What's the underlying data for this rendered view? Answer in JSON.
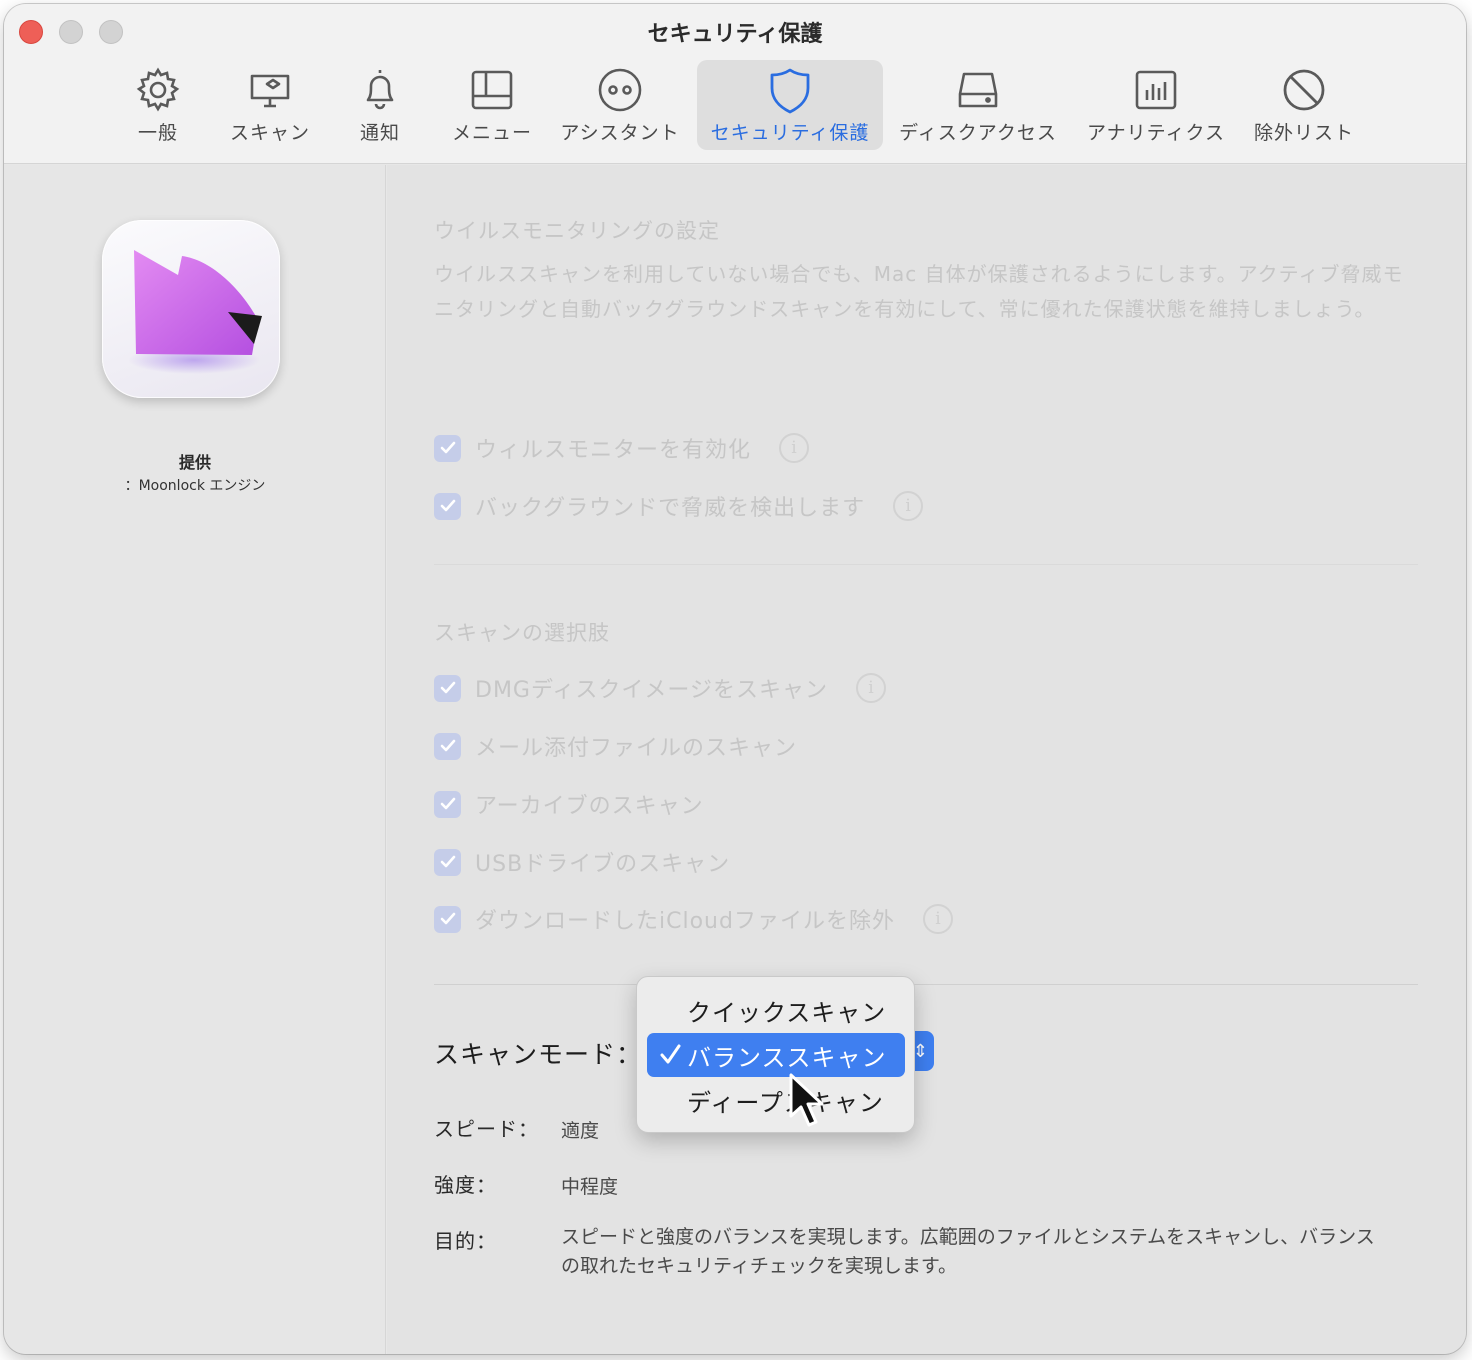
{
  "window": {
    "title": "セキュリティ保護"
  },
  "toolbar": {
    "tabs": [
      {
        "label": "一般",
        "icon": "gear-icon"
      },
      {
        "label": "スキャン",
        "icon": "monitor-icon"
      },
      {
        "label": "通知",
        "icon": "bell-icon"
      },
      {
        "label": "メニュー",
        "icon": "menu-bar-icon"
      },
      {
        "label": "アシスタント",
        "icon": "assistant-icon"
      },
      {
        "label": "セキュリティ保護",
        "icon": "shield-icon",
        "selected": true
      },
      {
        "label": "ディスクアクセス",
        "icon": "drive-icon"
      },
      {
        "label": "アナリティクス",
        "icon": "analytics-icon"
      },
      {
        "label": "除外リスト",
        "icon": "prohibited-icon"
      }
    ]
  },
  "sidebar": {
    "provided_label": "提供",
    "provided_value": "：Moonlock エンジン"
  },
  "virus_monitoring": {
    "title": "ウイルスモニタリングの設定",
    "description": "ウイルススキャンを利用していない場合でも、Mac 自体が保護されるようにします。アクティブ脅威モニタリングと自動バックグラウンドスキャンを有効にして、常に優れた保護状態を維持しましょう。",
    "options": [
      {
        "label": "ウィルスモニターを有効化",
        "checked": true,
        "info": true
      },
      {
        "label": "バックグラウンドで脅威を検出します",
        "checked": true,
        "info": true
      }
    ]
  },
  "scan_options": {
    "title": "スキャンの選択肢",
    "options": [
      {
        "label": "DMGディスクイメージをスキャン",
        "checked": true,
        "info": true
      },
      {
        "label": "メール添付ファイルのスキャン",
        "checked": true,
        "info": false
      },
      {
        "label": "アーカイブのスキャン",
        "checked": true,
        "info": false
      },
      {
        "label": "USBドライブのスキャン",
        "checked": true,
        "info": false
      },
      {
        "label": "ダウンロードしたiCloudファイルを除外",
        "checked": true,
        "info": true
      }
    ]
  },
  "scan_mode": {
    "label": "スキャンモード：",
    "menu_items": [
      {
        "label": "クイックスキャン",
        "selected": false
      },
      {
        "label": "バランススキャン",
        "selected": true
      },
      {
        "label": "ディープスキャン",
        "selected": false
      }
    ]
  },
  "details": {
    "speed_label": "スピード：",
    "speed_value": "適度",
    "strength_label": "強度：",
    "strength_value": "中程度",
    "purpose_label": "目的：",
    "purpose_value": "スピードと強度のバランスを実現します。広範囲のファイルとシステムをスキャンし、バランスの取れたセキュリティチェックを実現します。"
  },
  "colors": {
    "accent": "#3f7ff0",
    "close_button": "#ee5f57",
    "checkbox_disabled": "#c5cde9"
  }
}
